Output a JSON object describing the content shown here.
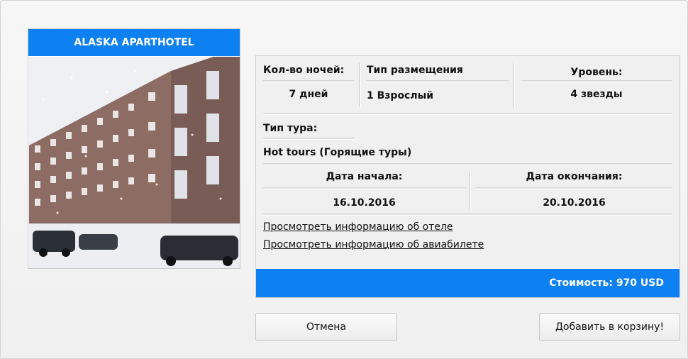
{
  "hotel": {
    "name": "ALASKA APARTHOTEL",
    "photo_alt": "Hotel building in snow"
  },
  "details": {
    "nights_label": "Кол-во ночей:",
    "nights_value": "7 дней",
    "accommodation_label": "Тип размещения",
    "accommodation_value": "1 Взрослый",
    "level_label": "Уровень:",
    "level_value": "4 звезды",
    "tour_type_label": "Тип тура:",
    "tour_type_value": "Hot tours (Горящие туры)",
    "start_date_label": "Дата начала:",
    "start_date_value": "16.10.2016",
    "end_date_label": "Дата окончания:",
    "end_date_value": "20.10.2016",
    "hotel_info_link": "Просмотреть информацию об отеле",
    "ticket_info_link": "Просмотреть информацию об авиабилете",
    "price": "Стоимость: 970 USD"
  },
  "actions": {
    "cancel_label": "Отмена",
    "add_to_cart_label": "Добавить в корзину!"
  },
  "colors": {
    "accent": "#0d80f2",
    "panel_bg": "#f0f0f0"
  }
}
